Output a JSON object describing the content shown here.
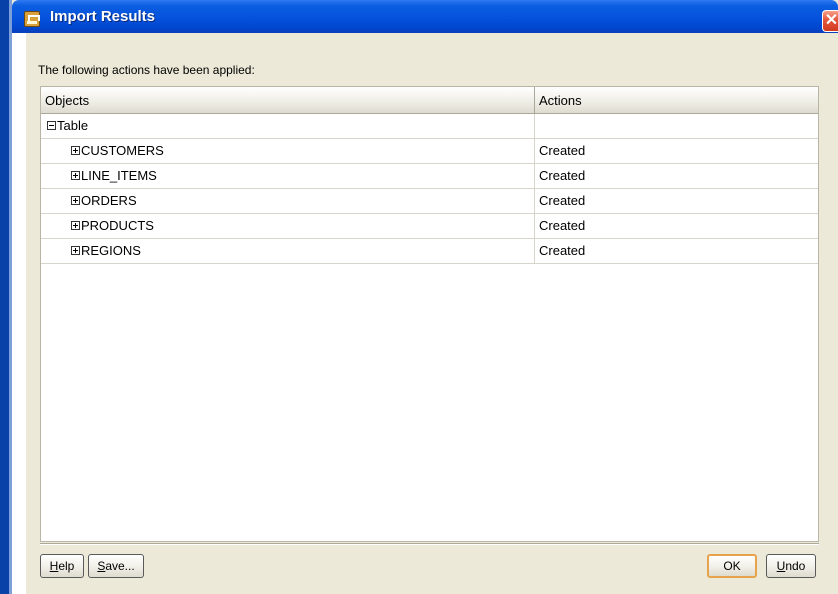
{
  "window": {
    "title": "Import Results",
    "close_glyph": "✕"
  },
  "intro": "The following actions have been applied:",
  "table": {
    "columns": [
      "Objects",
      "Actions"
    ],
    "group": {
      "label": "Table",
      "action": ""
    },
    "rows": [
      {
        "label": "CUSTOMERS",
        "action": "Created"
      },
      {
        "label": "LINE_ITEMS",
        "action": "Created"
      },
      {
        "label": "ORDERS",
        "action": "Created"
      },
      {
        "label": "PRODUCTS",
        "action": "Created"
      },
      {
        "label": "REGIONS",
        "action": "Created"
      }
    ]
  },
  "buttons": {
    "help": {
      "accel": "H",
      "rest": "elp"
    },
    "save": {
      "accel": "S",
      "rest": "ave..."
    },
    "ok": "OK",
    "undo": {
      "accel": "U",
      "rest": "ndo"
    }
  },
  "icons": {
    "window_icon": "app-window-icon",
    "close": "close-icon",
    "collapse": "collapse-minus-icon",
    "expand": "expand-plus-icon"
  },
  "colors": {
    "titlebar": "#0652dd",
    "dialog_bg": "#ece9d8",
    "close_button": "#e4553a",
    "default_button_border": "#e7a34c"
  }
}
